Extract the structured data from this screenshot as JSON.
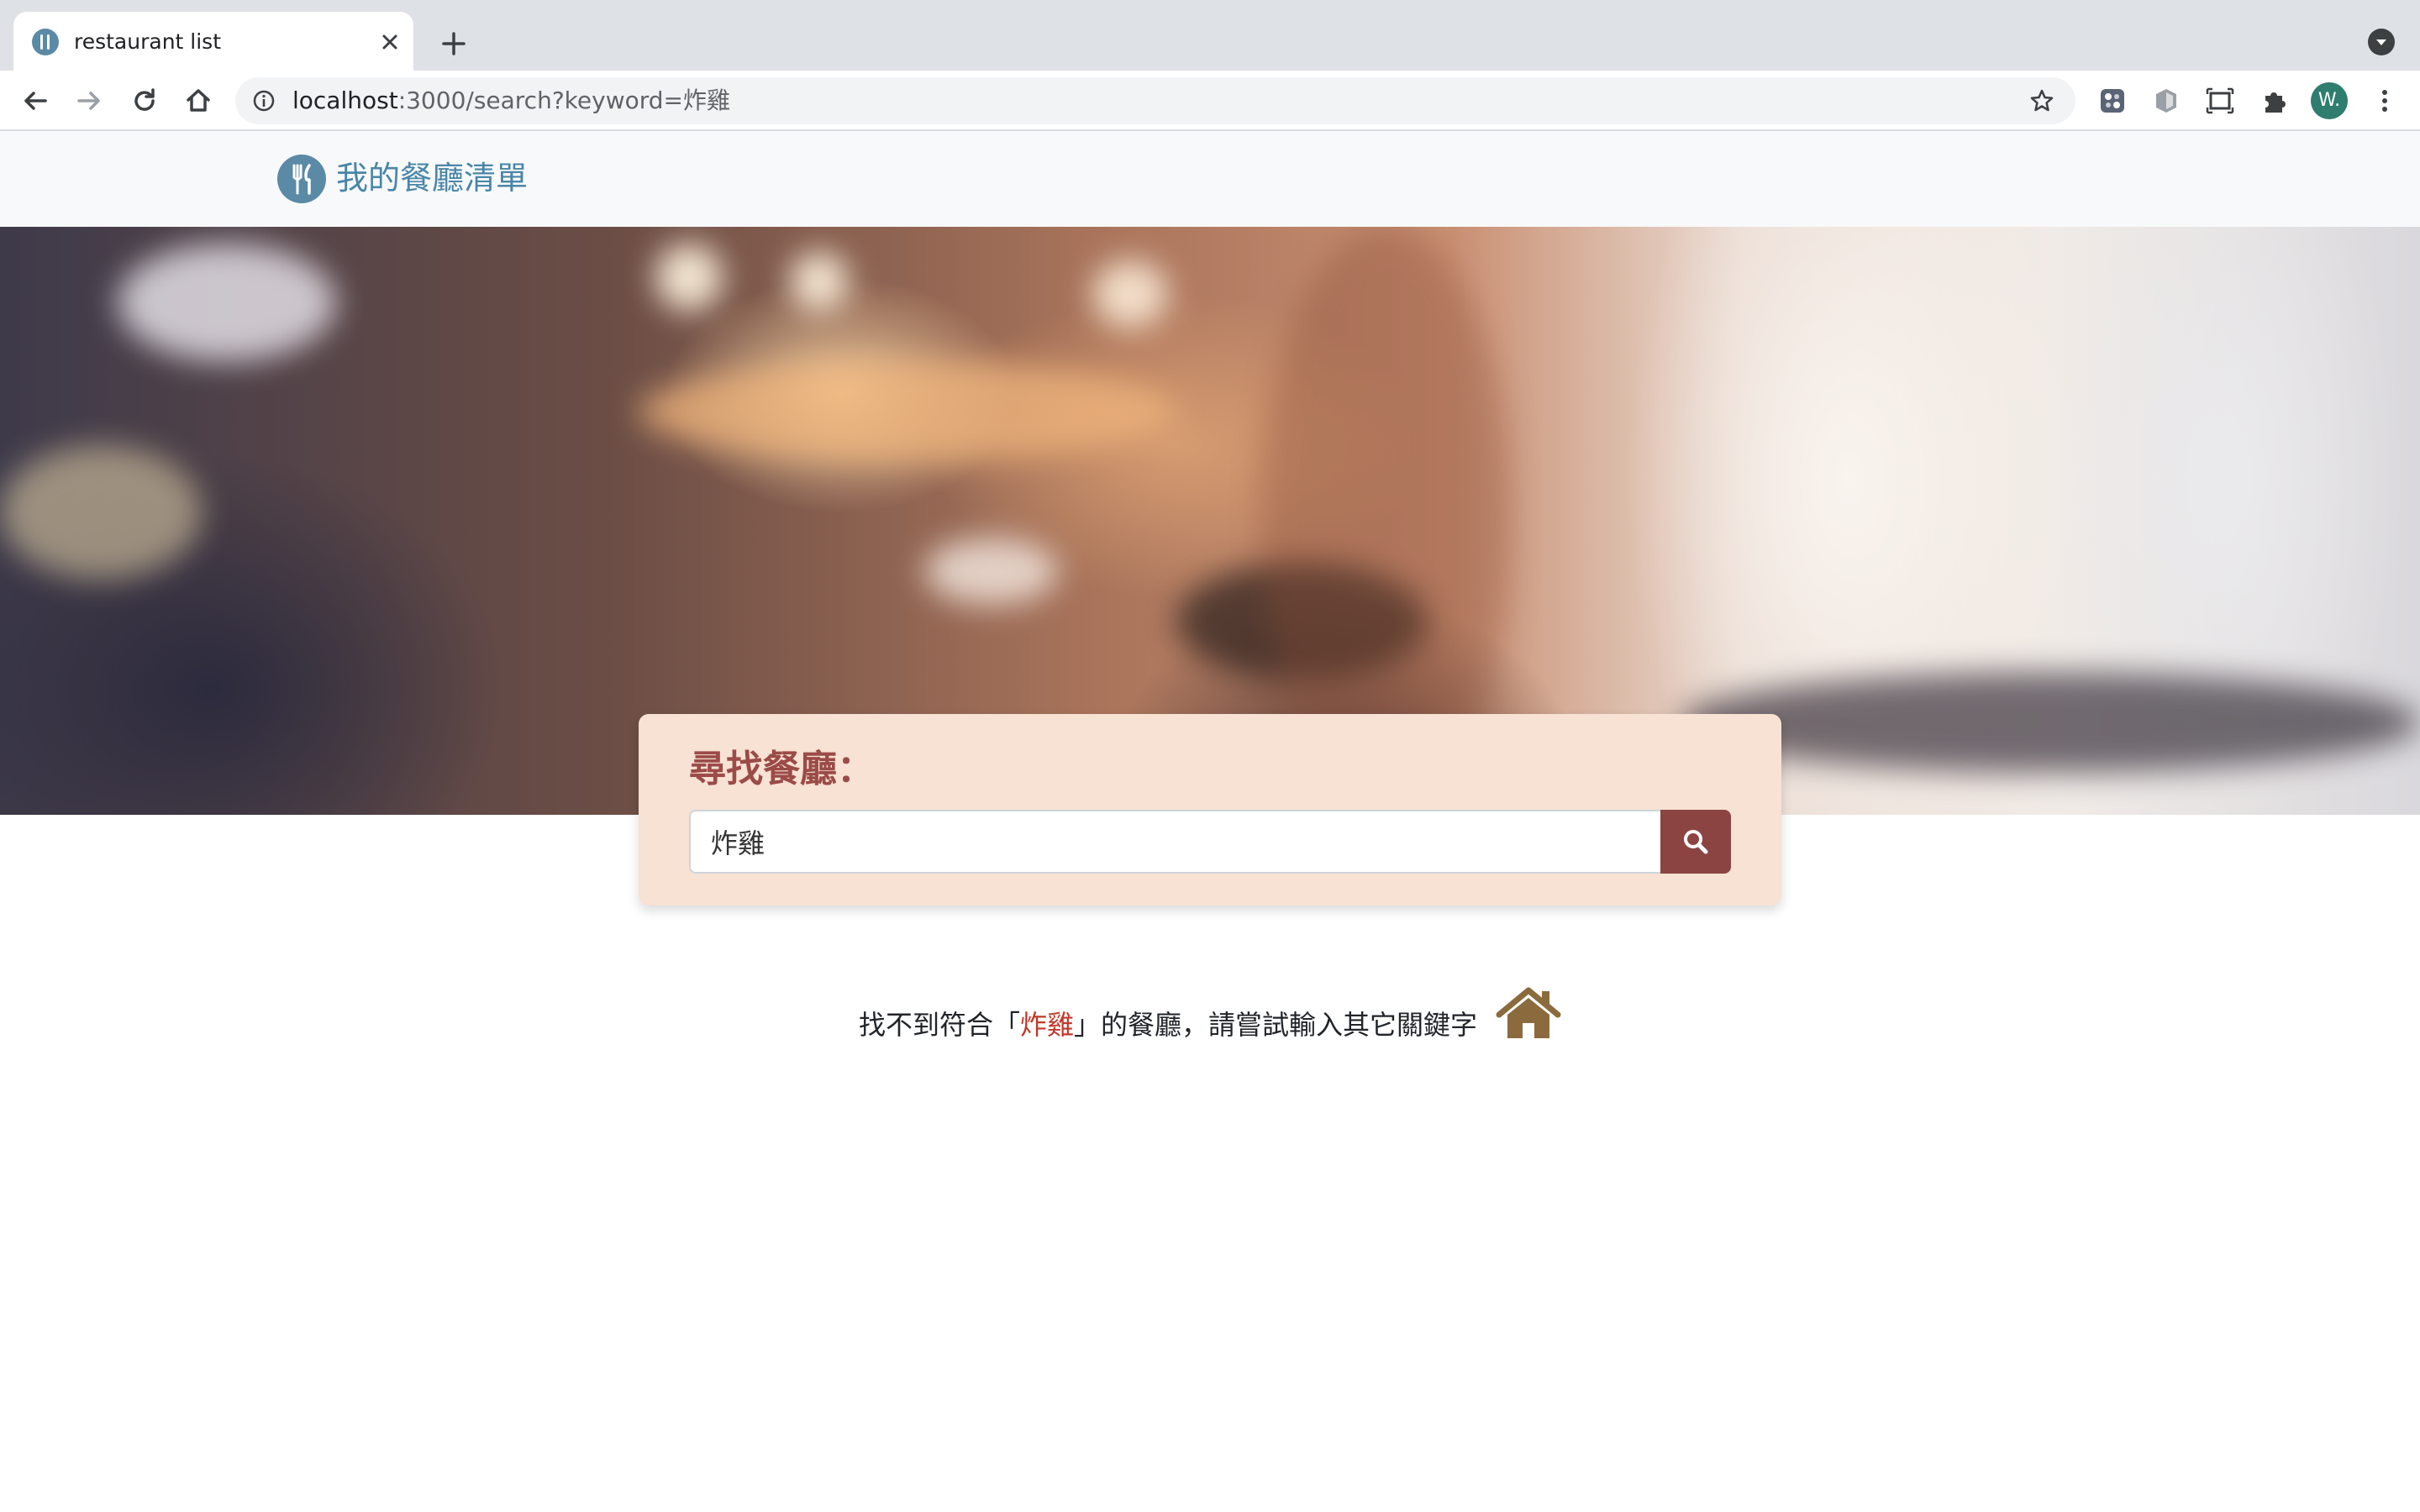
{
  "browser": {
    "tab_title": "restaurant list",
    "url_host": "localhost",
    "url_rest": ":3000/search?keyword=炸雞",
    "avatar_letter": "W."
  },
  "navbar": {
    "brand": "我的餐廳清單"
  },
  "search": {
    "title": "尋找餐廳：",
    "value": "炸雞"
  },
  "result": {
    "prefix": "找不到符合「",
    "keyword": "炸雞",
    "suffix": "」的餐廳，請嘗試輸入其它關鍵字"
  },
  "colors": {
    "brand": "#4a86a8",
    "search_panel": "#f7e2d3",
    "search_button": "#8c4443",
    "keyword": "#c0392b",
    "home_icon": "#8b6b3d"
  },
  "icons": {
    "favicon": "utensils-icon",
    "home": "home-icon",
    "search": "search-icon"
  }
}
